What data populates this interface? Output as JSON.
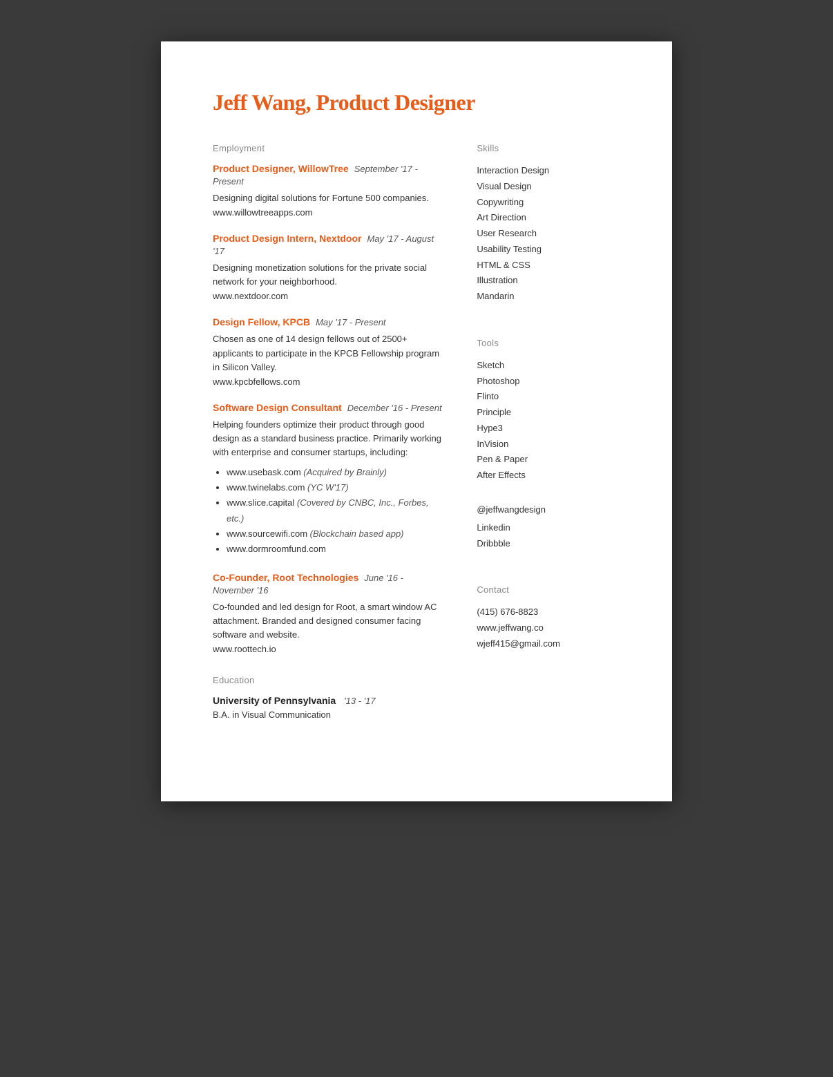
{
  "header": {
    "name": "Jeff Wang, Product Designer"
  },
  "left": {
    "employment_label": "Employment",
    "jobs": [
      {
        "title": "Product Designer, WillowTree",
        "date": "September '17 - Present",
        "description": "Designing digital solutions for Fortune 500 companies.",
        "url": "www.willowtreeapps.com",
        "url_list": []
      },
      {
        "title": "Product Design Intern, Nextdoor",
        "date": "May '17 - August '17",
        "description": "Designing monetization solutions for the private social network for your neighborhood.",
        "url": "www.nextdoor.com",
        "url_list": []
      },
      {
        "title": "Design Fellow, KPCB",
        "date": "May '17 - Present",
        "description": "Chosen as one of 14 design fellows out of 2500+ applicants to participate in the KPCB Fellowship program in Silicon Valley.",
        "url": "www.kpcbfellows.com",
        "url_list": []
      },
      {
        "title": "Software Design Consultant",
        "date": "December '16 - Present",
        "description": "Helping founders optimize their product through good design as a standard business practice. Primarily working with enterprise and consumer startups, including:",
        "url": "",
        "url_list": [
          {
            "text": "www.usebask.com",
            "note": "(Acquired by Brainly)"
          },
          {
            "text": "www.twinelabs.com",
            "note": "(YC W'17)"
          },
          {
            "text": "www.slice.capital",
            "note": "(Covered by CNBC, Inc., Forbes, etc.)"
          },
          {
            "text": "www.sourcewifi.com",
            "note": "(Blockchain based app)"
          },
          {
            "text": "www.dormroomfund.com",
            "note": ""
          }
        ]
      },
      {
        "title": "Co-Founder, Root Technologies",
        "date": "June '16 - November '16",
        "description": "Co-founded and led design for Root, a smart window AC attachment. Branded and designed consumer facing software and website.",
        "url": "www.roottech.io",
        "url_list": []
      }
    ],
    "education_label": "Education",
    "education": {
      "school": "University of Pennsylvania",
      "date": "'13 - '17",
      "degree": "B.A. in Visual Communication"
    }
  },
  "right": {
    "skills_label": "Skills",
    "skills": [
      "Interaction Design",
      "Visual Design",
      "Copywriting",
      "Art Direction",
      "User Research",
      "Usability Testing",
      "HTML & CSS",
      "Illustration",
      "Mandarin"
    ],
    "tools_label": "Tools",
    "tools": [
      "Sketch",
      "Photoshop",
      "Flinto",
      "Principle",
      "Hype3",
      "InVision",
      "Pen & Paper",
      "After Effects"
    ],
    "social_label": "@jeffwangdesign",
    "social": [
      "Linkedin",
      "Dribbble"
    ],
    "contact_label": "Contact",
    "contact": [
      "(415) 676-8823",
      "www.jeffwang.co",
      "wjeff415@gmail.com"
    ]
  }
}
